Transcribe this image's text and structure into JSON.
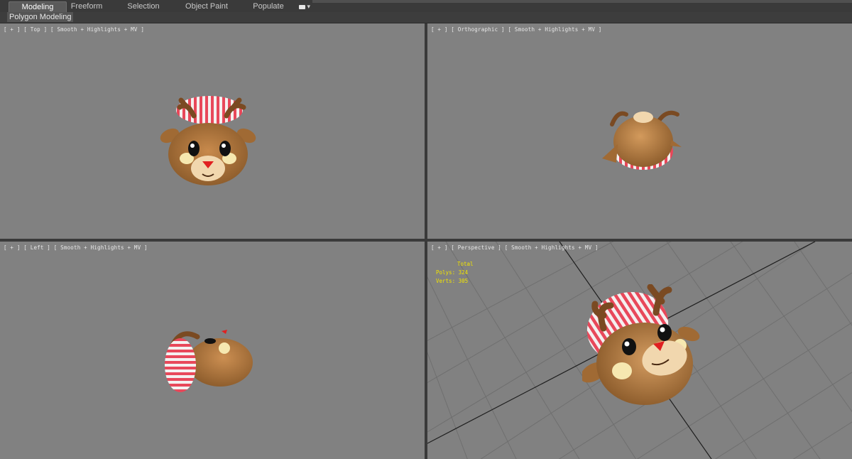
{
  "ribbon": {
    "tabs": [
      {
        "label": "Modeling",
        "active": true
      },
      {
        "label": "Freeform",
        "active": false
      },
      {
        "label": "Selection",
        "active": false
      },
      {
        "label": "Object Paint",
        "active": false
      },
      {
        "label": "Populate",
        "active": false
      }
    ],
    "extra_icon": "camera-dropdown-icon",
    "panel_title": "Polygon Modeling"
  },
  "viewports": {
    "top": {
      "label": "[ + ] [ Top ] [ Smooth + Highlights + MV ]"
    },
    "orthographic": {
      "label": "[ + ] [ Orthographic ] [ Smooth + Highlights + MV ]"
    },
    "left": {
      "label": "[ + ] [ Left ] [ Smooth + Highlights + MV ]"
    },
    "perspective": {
      "label": "[ + ] [ Perspective ] [ Smooth + Highlights + MV ]",
      "stats": {
        "total_label": "Total",
        "polys": "Polys: 324",
        "verts": "Verts: 305"
      }
    }
  },
  "colors": {
    "viewport_bg": "#818181",
    "fur": "#b07840",
    "stripe_red": "#e8485a",
    "nose": "#e02020",
    "stats_yellow": "#f2e400"
  }
}
